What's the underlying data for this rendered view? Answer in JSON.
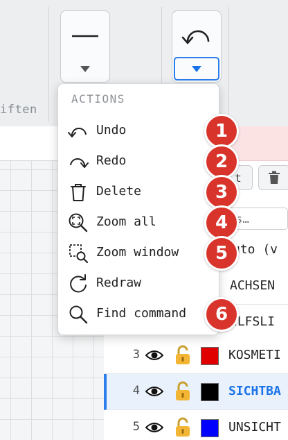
{
  "ribbon": {
    "group_label": "iften",
    "linetype_button": {
      "icon": "line-icon"
    },
    "undo_button": {
      "icon": "undo-icon"
    }
  },
  "panel": {
    "btn_text_partial": "t",
    "search_placeholder": "rs…",
    "mode_text": "uto (v",
    "layers": [
      {
        "num": "",
        "name": "ACHSEN",
        "color": ""
      },
      {
        "num": "",
        "name": "ILFSLI",
        "color": ""
      },
      {
        "num": "3",
        "name": "KOSMETI",
        "color": "#e00000",
        "visible": true,
        "locked": false
      },
      {
        "num": "4",
        "name": "SICHTBA",
        "color": "#000000",
        "visible": true,
        "locked": false,
        "selected": true
      },
      {
        "num": "5",
        "name": "UNSICHT",
        "color": "#0000ff",
        "visible": true,
        "locked": false
      }
    ]
  },
  "menu": {
    "header": "ACTIONS",
    "items": [
      {
        "label": "Undo",
        "icon": "undo-icon",
        "badge": "1"
      },
      {
        "label": "Redo",
        "icon": "redo-icon",
        "badge": "2"
      },
      {
        "label": "Delete",
        "icon": "trash-icon",
        "badge": "3"
      },
      {
        "label": "Zoom all",
        "icon": "zoom-all-icon",
        "badge": "4"
      },
      {
        "label": "Zoom window",
        "icon": "zoom-window-icon",
        "badge": "5"
      },
      {
        "label": "Redraw",
        "icon": "redraw-icon",
        "badge": ""
      },
      {
        "label": "Find command",
        "icon": "search-icon",
        "badge": "6"
      }
    ]
  },
  "colors": {
    "accent": "#2b7de9",
    "badge": "#d9342b",
    "selected_row_bg": "#e9f1fd"
  }
}
